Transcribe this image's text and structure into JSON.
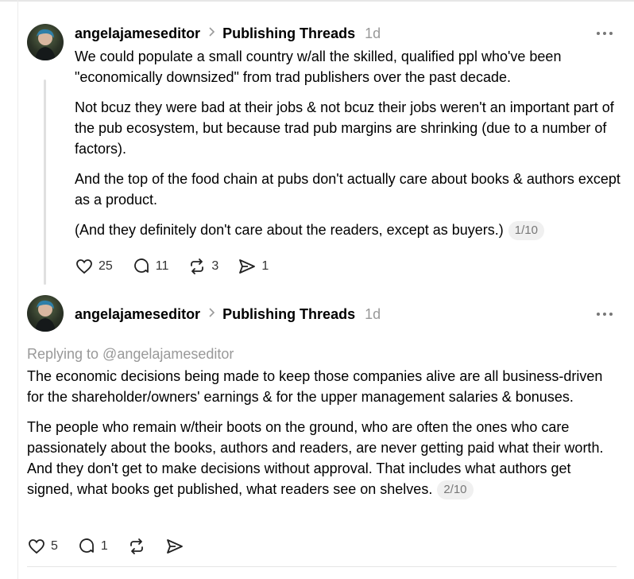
{
  "posts": [
    {
      "username": "angelajameseditor",
      "topic": "Publishing Threads",
      "time": "1d",
      "replying_to": "",
      "paragraphs": [
        "We could populate a small country w/all the skilled, qualified ppl who've been \"economically downsized\" from trad publishers over the past decade.",
        "Not bcuz they were bad at their jobs & not bcuz their jobs weren't an important part of the pub ecosystem, but because trad pub margins are shrinking (due to a number of factors).",
        "And the top of the food chain at pubs don't actually care about books & authors except as a product.",
        "(And they definitely don't care about the readers, except as buyers.)"
      ],
      "page": "1/10",
      "likes": "25",
      "replies": "11",
      "reposts": "3",
      "shares": "1"
    },
    {
      "username": "angelajameseditor",
      "topic": "Publishing Threads",
      "time": "1d",
      "replying_to": "Replying to @angelajameseditor",
      "paragraphs": [
        "The economic decisions being made to keep those companies alive are all business-driven for the shareholder/owners' earnings & for the upper management salaries & bonuses.",
        "The people who remain w/their boots on the ground, who are often the ones who care passionately about the books, authors and readers, are never getting paid what their worth. And they don't get to make decisions without approval. That includes what authors get signed, what books get published, what readers see on shelves."
      ],
      "page": "2/10",
      "likes": "5",
      "replies": "1",
      "reposts": "",
      "shares": ""
    }
  ],
  "icons": {
    "like": "heart-icon",
    "reply": "comment-icon",
    "repost": "repost-icon",
    "share": "share-icon",
    "more": "more-dots-icon",
    "chevron": "chevron-right-icon"
  },
  "colors": {
    "text": "#000000",
    "muted": "#999999",
    "pill_bg": "#f0f0f0",
    "thread_line": "#e0e0e0"
  }
}
